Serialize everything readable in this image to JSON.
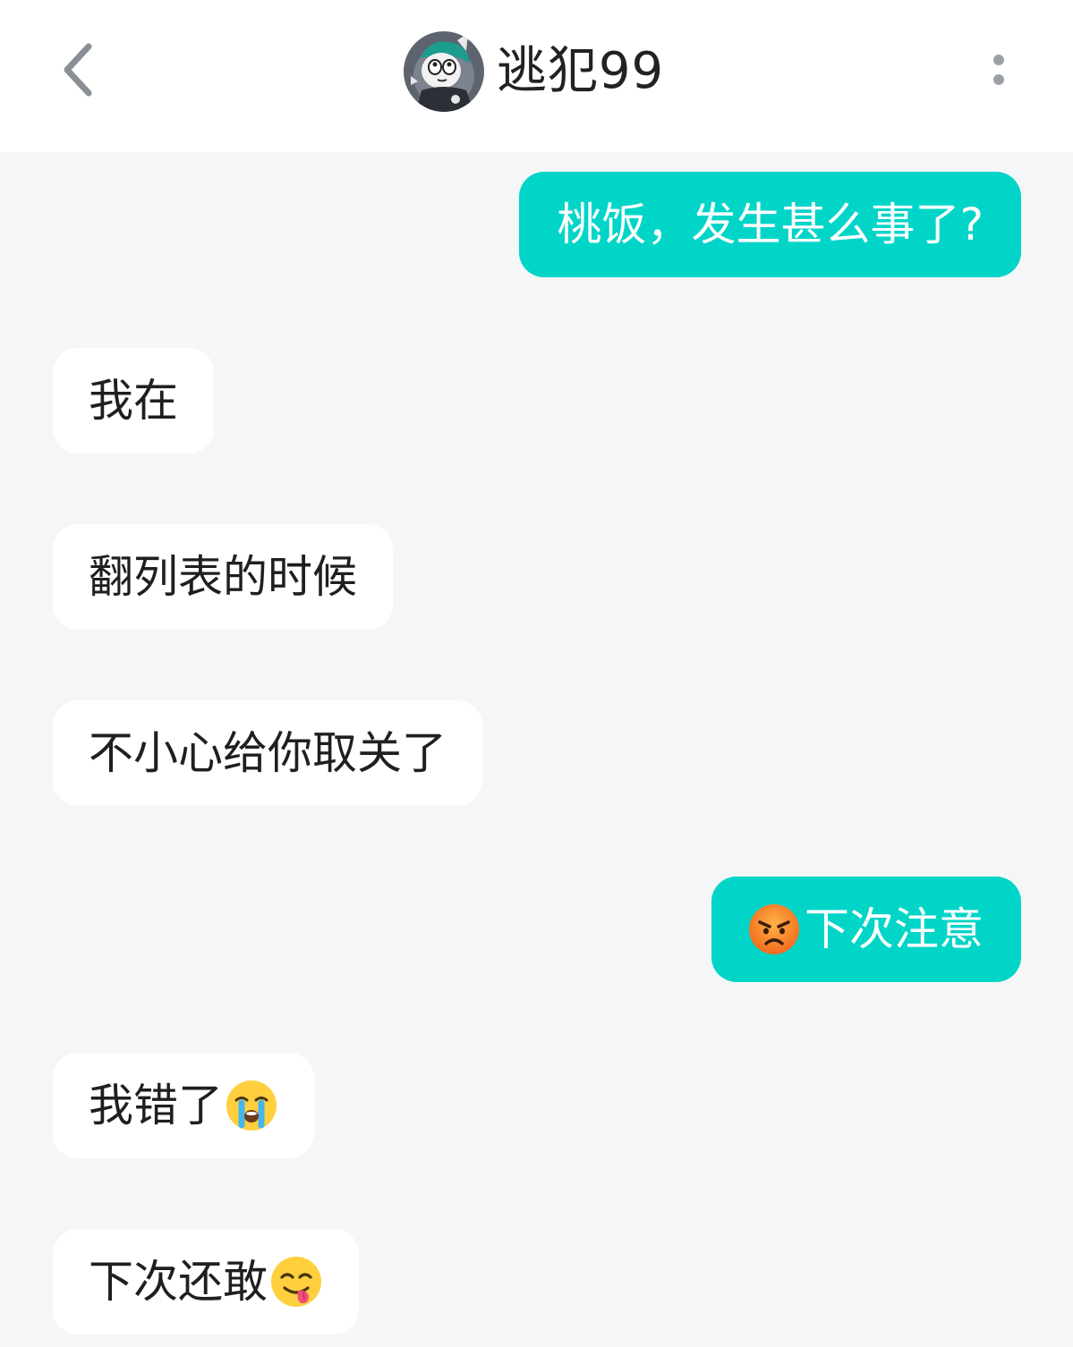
{
  "header": {
    "title": "逃犯99"
  },
  "messages": [
    {
      "direction": "out",
      "text": "桃饭，发生甚么事了?"
    },
    {
      "direction": "in",
      "text": "我在"
    },
    {
      "direction": "in",
      "text": "翻列表的时候"
    },
    {
      "direction": "in",
      "text": "不小心给你取关了"
    },
    {
      "direction": "out",
      "text": "下次注意",
      "emoji_before": "angry-face-icon"
    },
    {
      "direction": "in",
      "text": "我错了",
      "emoji_after": "loudly-crying-face-icon"
    },
    {
      "direction": "in",
      "text": "下次还敢",
      "emoji_after": "face-savoring-food-icon"
    }
  ],
  "colors": {
    "outgoing_bubble": "#00d5c8",
    "incoming_bubble": "#ffffff",
    "background": "#f5f6f8"
  }
}
